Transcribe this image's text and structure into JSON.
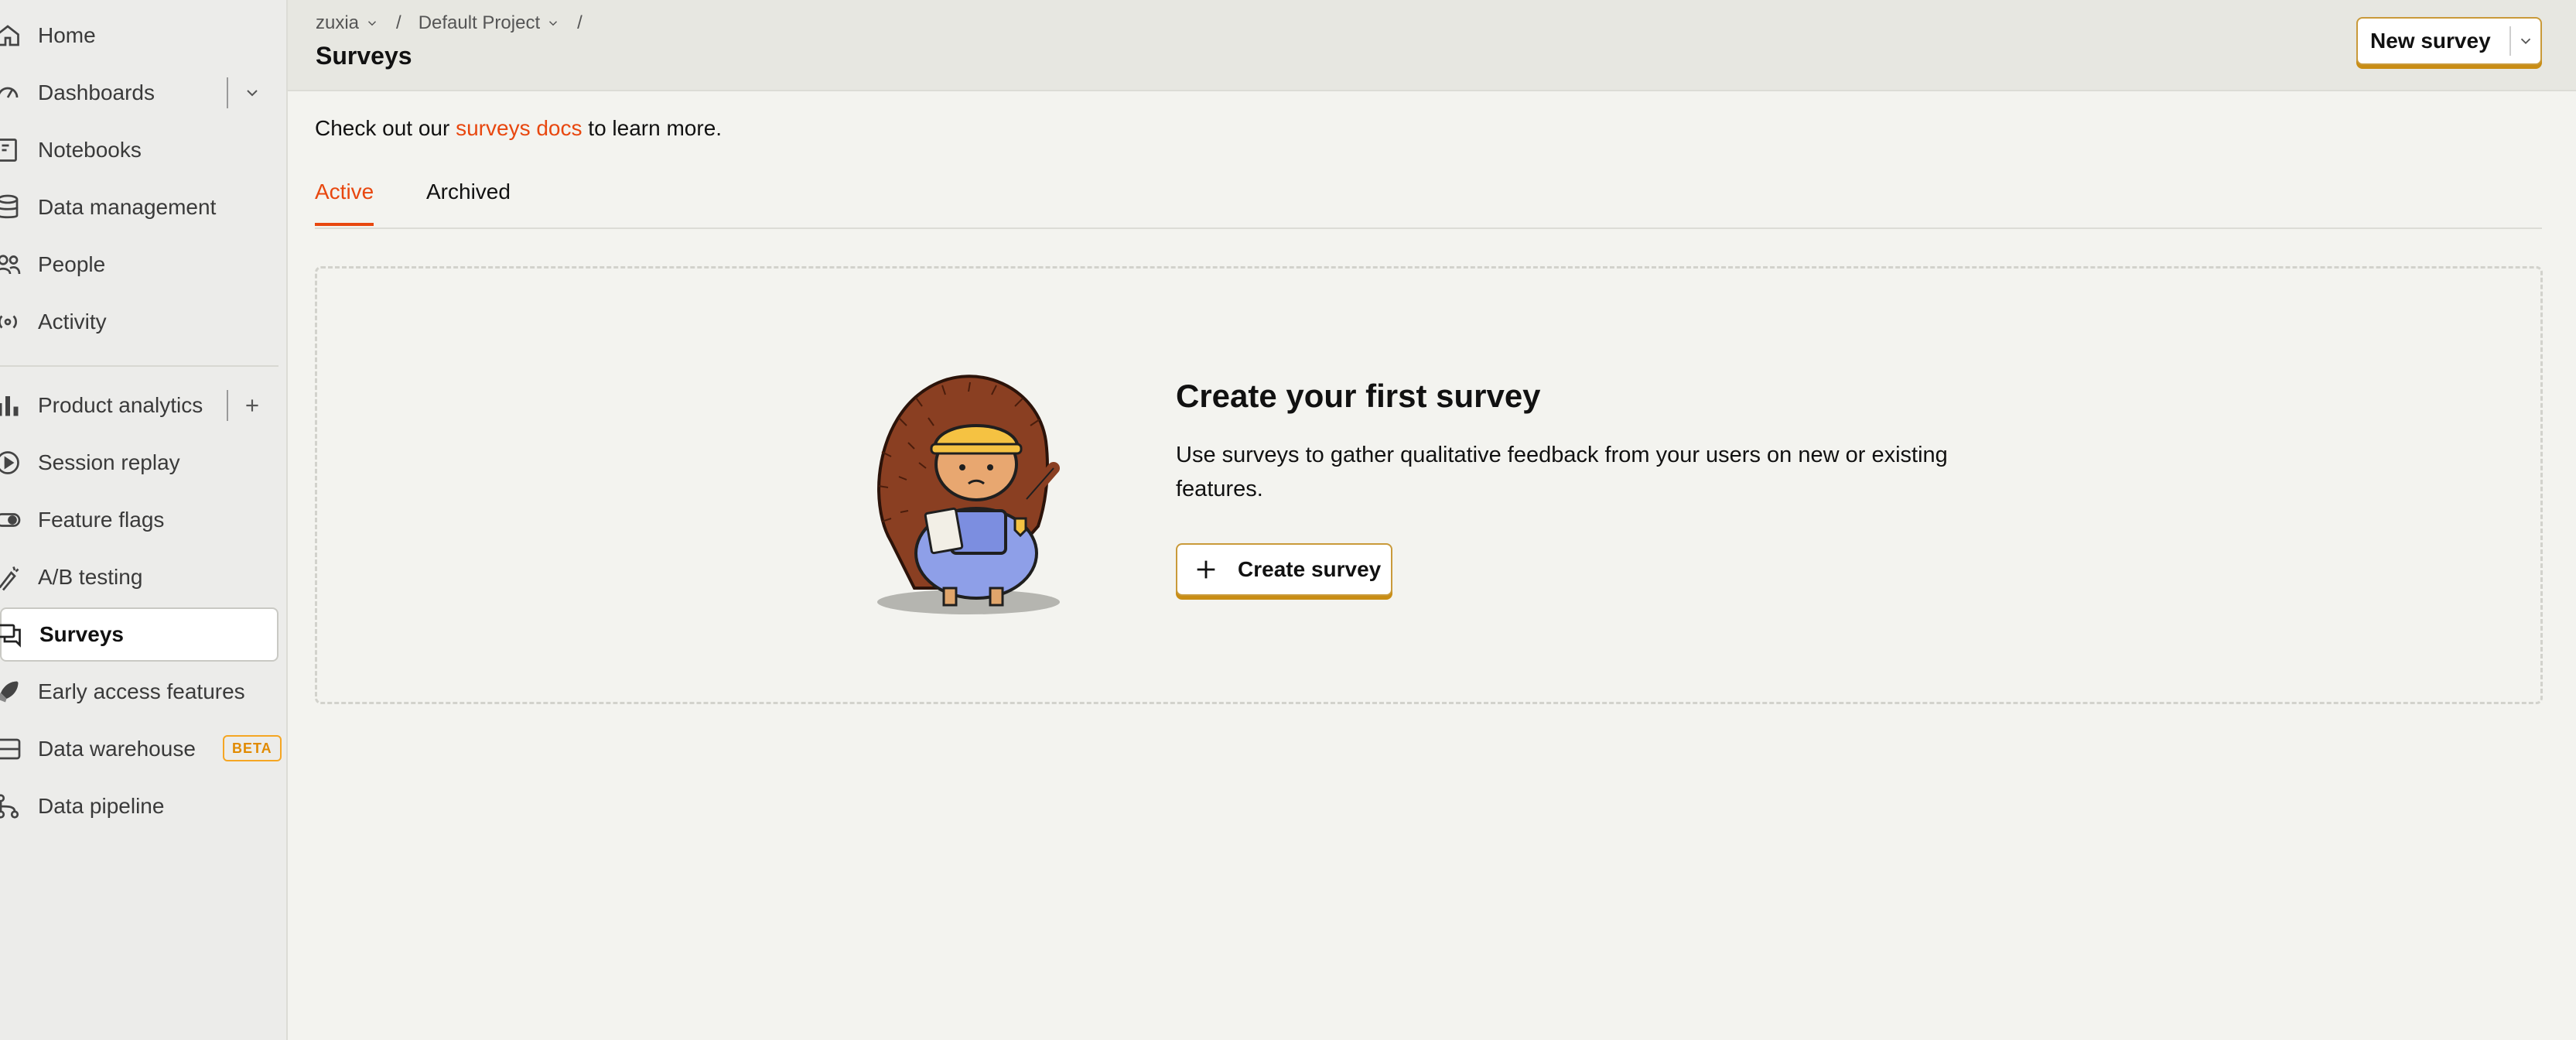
{
  "sidebar": {
    "items": [
      {
        "label": "Home",
        "icon": "home-icon"
      },
      {
        "label": "Dashboards",
        "icon": "dashboard-icon"
      },
      {
        "label": "Notebooks",
        "icon": "notebook-icon"
      },
      {
        "label": "Data management",
        "icon": "database-icon"
      },
      {
        "label": "People",
        "icon": "people-icon"
      },
      {
        "label": "Activity",
        "icon": "activity-icon"
      },
      {
        "label": "Product analytics",
        "icon": "bar-chart-icon"
      },
      {
        "label": "Session replay",
        "icon": "replay-icon"
      },
      {
        "label": "Feature flags",
        "icon": "toggle-icon"
      },
      {
        "label": "A/B testing",
        "icon": "flask-icon"
      },
      {
        "label": "Surveys",
        "icon": "chat-icon",
        "active": true
      },
      {
        "label": "Early access features",
        "icon": "rocket-icon"
      },
      {
        "label": "Data warehouse",
        "icon": "warehouse-icon",
        "badge": "BETA"
      },
      {
        "label": "Data pipeline",
        "icon": "pipeline-icon"
      }
    ]
  },
  "topbar": {
    "breadcrumb": [
      "zuxia",
      "Default Project"
    ],
    "title": "Surveys",
    "new_survey_label": "New survey"
  },
  "main": {
    "intro_prefix": "Check out our ",
    "intro_link": "surveys docs",
    "intro_suffix": " to learn more.",
    "tabs": [
      {
        "label": "Active",
        "active": true
      },
      {
        "label": "Archived"
      }
    ],
    "empty": {
      "title": "Create your first survey",
      "description": "Use surveys to gather qualitative feedback from your users on new or existing features.",
      "button_label": "Create survey"
    }
  },
  "colors": {
    "accent": "#e8470f",
    "button_border": "#c99a3a",
    "beta": "#f5a623"
  }
}
